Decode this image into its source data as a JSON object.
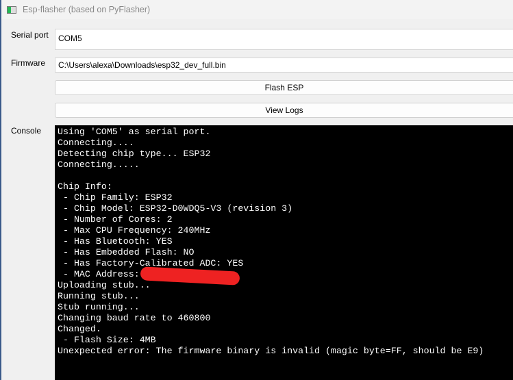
{
  "window": {
    "title": "Esp-flasher (based on PyFlasher)"
  },
  "serial_port": {
    "label": "Serial port",
    "value": "COM5"
  },
  "firmware": {
    "label": "Firmware",
    "value": "C:\\Users\\alexa\\Downloads\\esp32_dev_full.bin"
  },
  "buttons": {
    "flash": "Flash ESP",
    "logs": "View Logs"
  },
  "console": {
    "label": "Console",
    "lines": [
      "Using 'COM5' as serial port.",
      "Connecting....",
      "Detecting chip type... ESP32",
      "Connecting.....",
      "",
      "Chip Info:",
      " - Chip Family: ESP32",
      " - Chip Model: ESP32-D0WDQ5-V3 (revision 3)",
      " - Number of Cores: 2",
      " - Max CPU Frequency: 240MHz",
      " - Has Bluetooth: YES",
      " - Has Embedded Flash: NO",
      " - Has Factory-Calibrated ADC: YES",
      " - MAC Address:",
      "Uploading stub...",
      "Running stub...",
      "Stub running...",
      "Changing baud rate to 460800",
      "Changed.",
      " - Flash Size: 4MB",
      "Unexpected error: The firmware binary is invalid (magic byte=FF, should be E9)"
    ]
  }
}
